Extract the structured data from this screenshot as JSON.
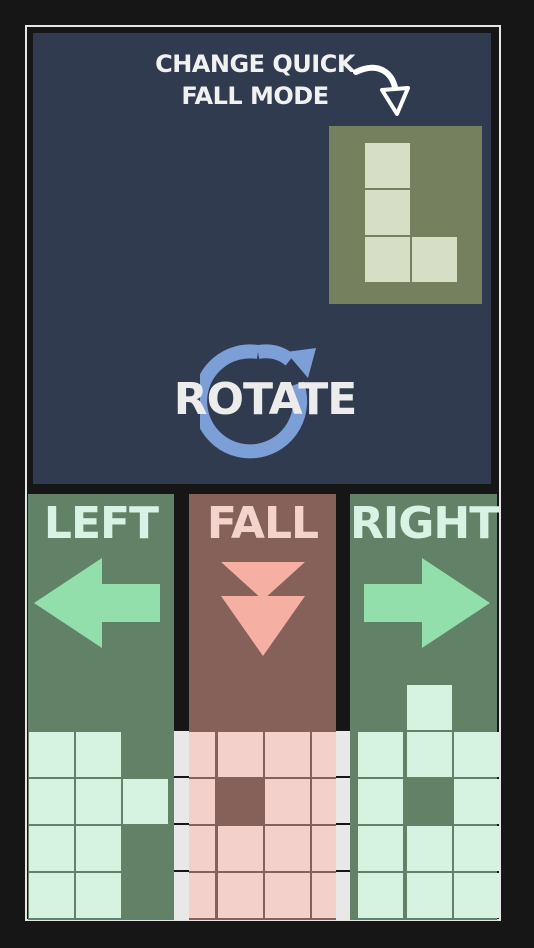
{
  "top": {
    "hint_line1": "CHANGE QUICK",
    "hint_line2": "FALL MODE",
    "rotate_label": "ROTATE",
    "rotate_icon": "rotate-clockwise-icon",
    "hint_arrow_icon": "curved-arrow-down-icon"
  },
  "controls": {
    "left_label": "LEFT",
    "fall_label": "FALL",
    "right_label": "RIGHT",
    "left_icon": "arrow-left-icon",
    "fall_icon": "double-chevron-down-icon",
    "right_icon": "arrow-right-icon"
  },
  "colors": {
    "panel": "#303b4f",
    "preview_bg": "#75805f",
    "preview_block": "#d6dfc6",
    "green_column": "#628268",
    "fall_column": "#856159",
    "green_arrow": "#93dfac",
    "fall_arrow": "#f5b0a3",
    "rotate_icon": "#7b9fd6"
  }
}
